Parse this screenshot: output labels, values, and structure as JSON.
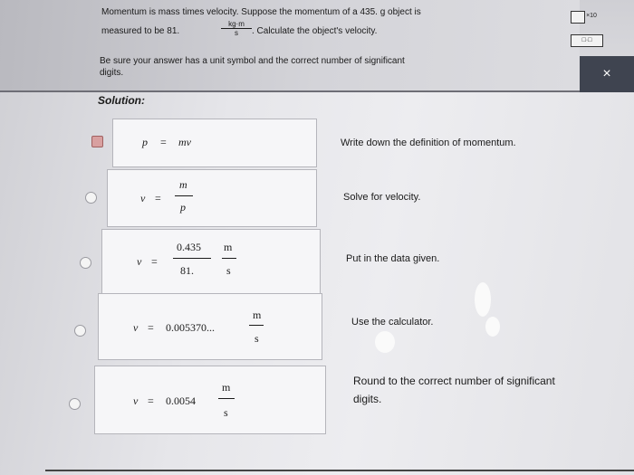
{
  "question": {
    "line1_a": "Momentum is mass times velocity. Suppose the momentum of a 435. g object is",
    "line2_a": "measured to be 81.",
    "unit_num": "kg·m",
    "unit_den": "s",
    "line2_b": ". Calculate the object's velocity.",
    "line3": "Be sure your answer has a unit symbol and the correct number of significant",
    "line4": "digits."
  },
  "toolbar": {
    "btn1": "",
    "btn1_sub": "×10",
    "btn2": "□·□",
    "btn3": "",
    "close": "×"
  },
  "solution": {
    "label": "Solution:",
    "steps": [
      {
        "selected": true,
        "p": "p",
        "eq": "=",
        "m": "mv",
        "explain": "Write down the definition of momentum."
      },
      {
        "selected": false,
        "lhs": "v",
        "eq": "=",
        "num": "m",
        "den": "p",
        "explain": "Solve for velocity."
      },
      {
        "selected": false,
        "lhs": "v",
        "eq": "=",
        "num": "0.435",
        "den": "81.",
        "unum": "m",
        "uden": "s",
        "explain": "Put in the data given."
      },
      {
        "selected": false,
        "lhs": "v",
        "eq": "=",
        "val": "0.005370...",
        "unum": "m",
        "uden": "s",
        "explain": "Use the calculator."
      },
      {
        "selected": false,
        "lhs": "v",
        "eq": "=",
        "val": "0.0054",
        "unum": "m",
        "uden": "s",
        "explain": "Round to the correct number of significant",
        "explain2": "digits."
      }
    ]
  }
}
